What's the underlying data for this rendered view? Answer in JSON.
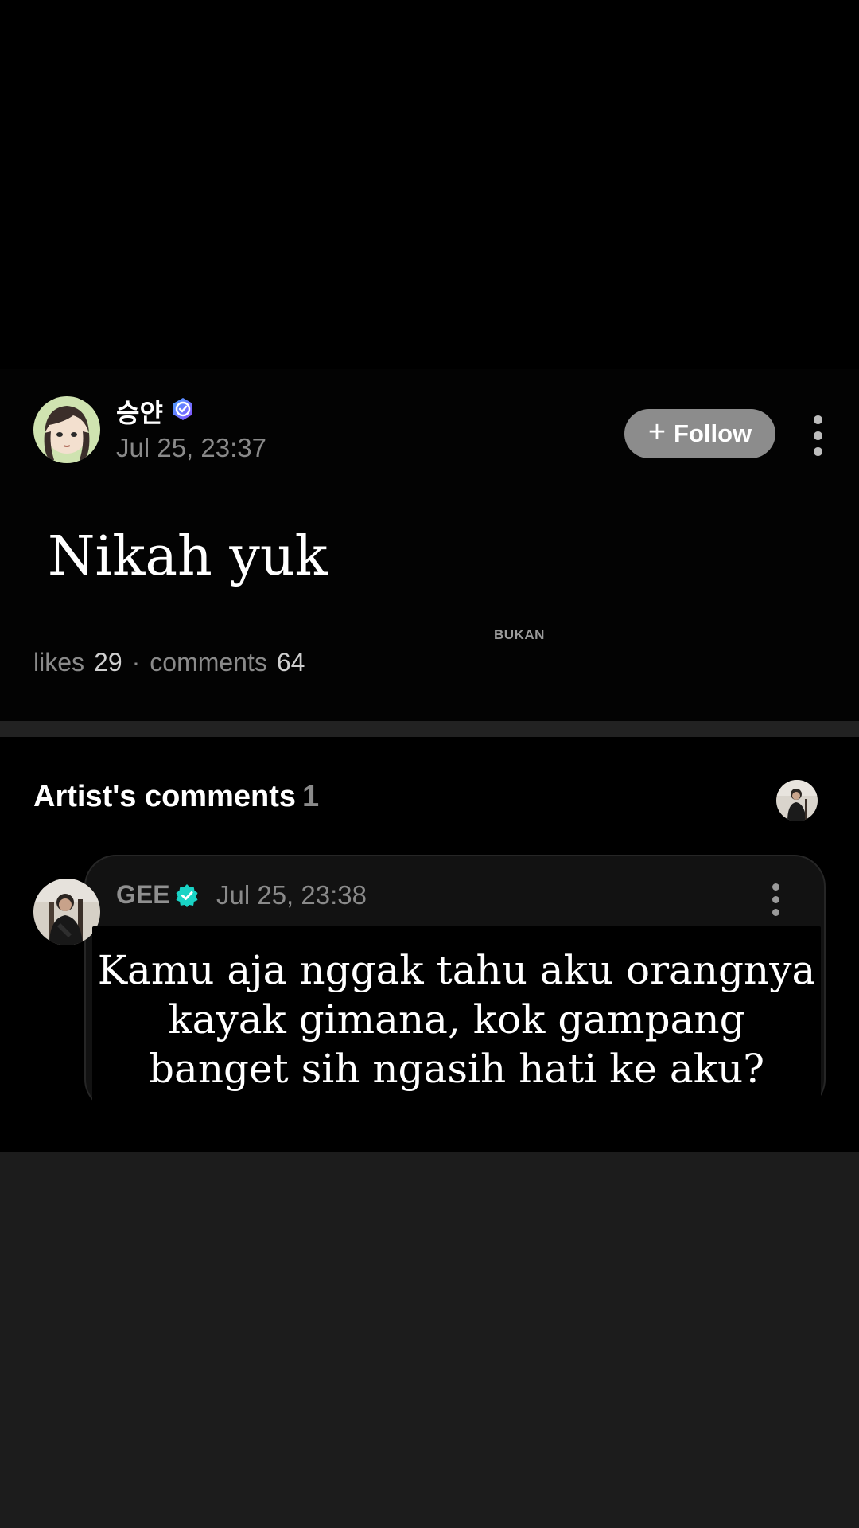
{
  "post": {
    "author": "승얀",
    "date": "Jul 25, 23:37",
    "follow_label": "Follow",
    "body": "Nikah yuk",
    "watermark": "BUKAN",
    "likes_label": "likes",
    "likes_count": "29",
    "separator": "·",
    "comments_label": "comments",
    "comments_count": "64"
  },
  "artist_comments": {
    "title": "Artist's comments",
    "count": "1",
    "comment": {
      "author": "GEE",
      "date": "Jul 25, 23:38",
      "text": "Kamu aja nggak tahu aku orangnya kayak gimana, kok gampang banget sih ngasih hati ke aku?"
    }
  },
  "colors": {
    "background": "#000000",
    "follow_button": "#8c8c8c",
    "verified_purple": "#7b5cff",
    "verified_teal": "#19d3c5",
    "muted_text": "#8a8a8a"
  }
}
